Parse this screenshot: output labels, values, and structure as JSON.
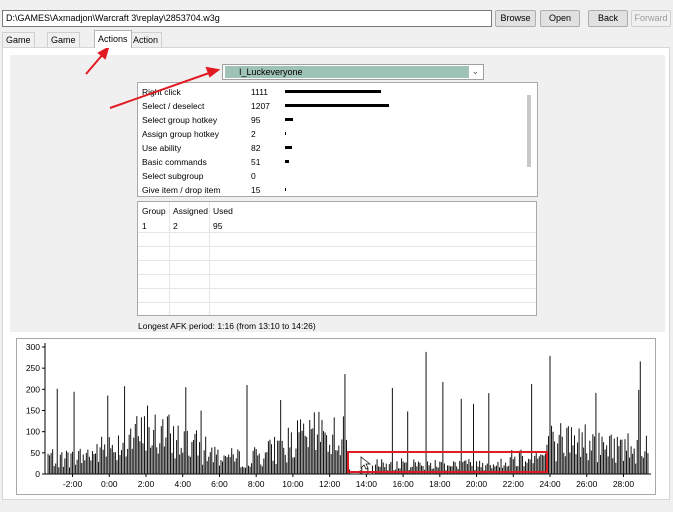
{
  "toolbar": {
    "path": "D:\\GAMES\\Axmadjon\\Warcraft 3\\replay\\2853704.w3g",
    "browse_label": "Browse",
    "open_label": "Open",
    "back_label": "Back",
    "forward_label": "Forward"
  },
  "tabs": [
    {
      "label": "Game Info"
    },
    {
      "label": "Game Chat"
    },
    {
      "label": "Actions"
    },
    {
      "label": "Action Log"
    }
  ],
  "player_select": {
    "value": "I_Luckeveryone",
    "icon": "player-portrait-icon"
  },
  "actions": [
    {
      "label": "Right click",
      "value": "1111",
      "bar": 1111
    },
    {
      "label": "Select / deselect",
      "value": "1207",
      "bar": 1207
    },
    {
      "label": "Select group hotkey",
      "value": "95",
      "bar": 95
    },
    {
      "label": "Assign group hotkey",
      "value": "2",
      "bar": 2
    },
    {
      "label": "Use ability",
      "value": "82",
      "bar": 82
    },
    {
      "label": "Basic commands",
      "value": "51",
      "bar": 51
    },
    {
      "label": "Select subgroup",
      "value": "0",
      "bar": 0
    },
    {
      "label": "Give item / drop item",
      "value": "15",
      "bar": 15
    }
  ],
  "groups": {
    "headers": [
      "Group",
      "Assigned",
      "Used"
    ],
    "rows": [
      [
        "1",
        "2",
        "95"
      ]
    ]
  },
  "afk": {
    "text": "Longest AFK period: 1:16 (from 13:10 to 14:26)"
  },
  "colors": {
    "annotation": "#e11b22",
    "combo_highlight": "#9fc2b6"
  },
  "chart_data": {
    "type": "bar",
    "title": "",
    "xlabel": "",
    "ylabel": "",
    "ylim": [
      0,
      300
    ],
    "yticks": [
      "300",
      "250",
      "200",
      "150",
      "100",
      "50",
      "0"
    ],
    "xlim": [
      -210,
      1770
    ],
    "xticks": [
      "-2:00",
      "0:00",
      "2:00",
      "4:00",
      "6:00",
      "8:00",
      "10:00",
      "12:00",
      "14:00",
      "16:00",
      "18:00",
      "20:00",
      "22:00",
      "24:00",
      "26:00",
      "28:00"
    ],
    "grid": false,
    "legend": "none",
    "highlight_range": [
      780,
      1430
    ]
  }
}
